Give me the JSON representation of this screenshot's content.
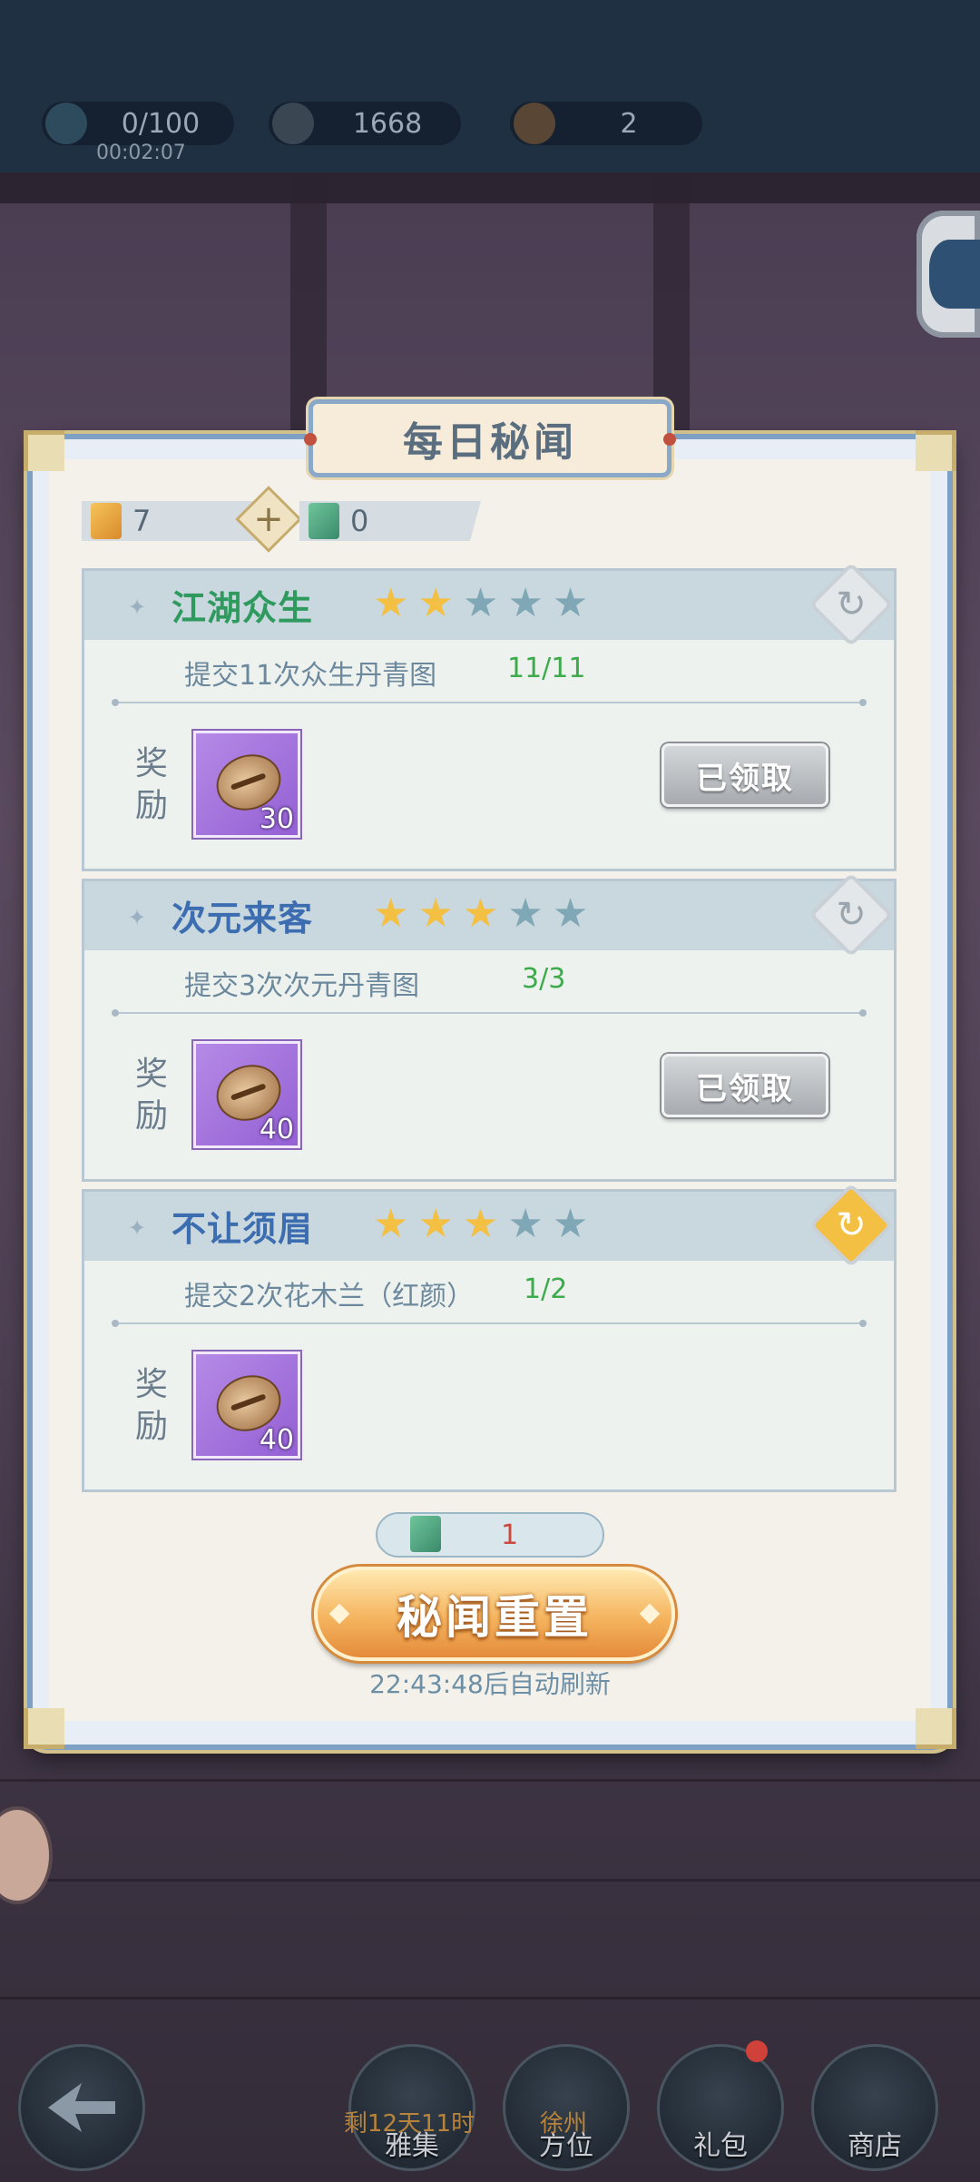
{
  "resources": [
    {
      "icon": "spirit-icon",
      "value": "0/100"
    },
    {
      "icon": "coin-icon",
      "value": "1668"
    },
    {
      "icon": "shell-icon",
      "value": "2"
    }
  ],
  "resource_timer": "00:02:07",
  "panel": {
    "title": "每日秘闻",
    "currency_a": {
      "icon": "scroll-ticket-icon",
      "value": "7"
    },
    "plus_symbol": "+",
    "currency_b": {
      "icon": "jade-ticket-icon",
      "value": "0"
    }
  },
  "tasks": [
    {
      "name": "江湖众生",
      "name_color": "#2f9a5e",
      "stars_filled": 2,
      "stars_total": 5,
      "description": "提交11次众生丹青图",
      "progress": "11/11",
      "reward_label": "奖励",
      "reward_count": "30",
      "claim_label": "已领取",
      "refresh_active": false
    },
    {
      "name": "次元来客",
      "name_color": "#3b6db0",
      "stars_filled": 3,
      "stars_total": 5,
      "description": "提交3次次元丹青图",
      "progress": "3/3",
      "reward_label": "奖励",
      "reward_count": "40",
      "claim_label": "已领取",
      "refresh_active": false
    },
    {
      "name": "不让须眉",
      "name_color": "#3b6db0",
      "stars_filled": 3,
      "stars_total": 5,
      "description": "提交2次花木兰（红颜）",
      "progress": "1/2",
      "reward_label": "奖励",
      "reward_count": "40",
      "claim_label": "",
      "refresh_active": true
    }
  ],
  "reset": {
    "cost_icon": "jade-ticket-icon",
    "cost_value": "1",
    "button_label": "秘闻重置",
    "refresh_note": "22:43:48后自动刷新"
  },
  "bottom_nav": [
    {
      "label": "",
      "sub": "",
      "icon": "back-arrow-icon"
    },
    {
      "label": "雅集",
      "sub": "剩12天11时",
      "icon": "gallery-icon"
    },
    {
      "label": "方位",
      "sub": "徐州",
      "icon": "location-icon"
    },
    {
      "label": "礼包",
      "sub": "",
      "icon": "gift-icon",
      "badge": true
    },
    {
      "label": "商店",
      "sub": "",
      "icon": "shop-icon"
    }
  ],
  "colors": {
    "star_filled": "#f3c043",
    "star_empty": "#7fa7b5",
    "progress_green": "#3daa4b",
    "accent_gold": "#f5b45e",
    "refresh_active": "#f3c043"
  }
}
